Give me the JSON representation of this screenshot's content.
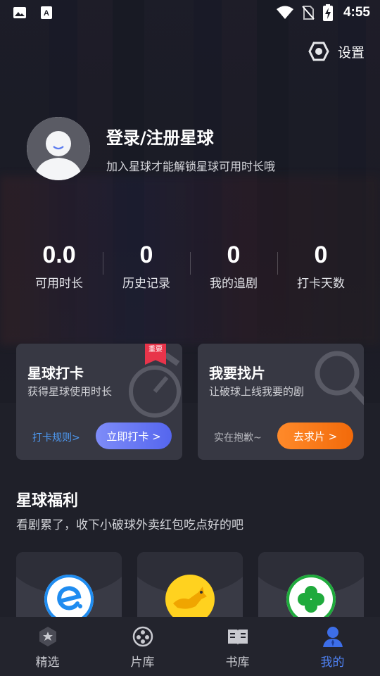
{
  "status_bar": {
    "time": "4:55",
    "icons": [
      "image-icon",
      "text-a-icon",
      "wifi-icon",
      "no-sim-icon",
      "battery-charging-icon"
    ]
  },
  "settings": {
    "label": "设置",
    "icon": "gear-icon"
  },
  "profile": {
    "title": "登录/注册星球",
    "subtitle": "加入星球才能解锁星球可用时长哦"
  },
  "stats": [
    {
      "value": "0.0",
      "label": "可用时长"
    },
    {
      "value": "0",
      "label": "历史记录"
    },
    {
      "value": "0",
      "label": "我的追剧"
    },
    {
      "value": "0",
      "label": "打卡天数"
    }
  ],
  "checkin_card": {
    "title": "星球打卡",
    "subtitle": "获得星球使用时长",
    "badge": "重要",
    "rules_link": "打卡规则>",
    "button": "立即打卡 >"
  },
  "request_card": {
    "title": "我要找片",
    "subtitle": "让破球上线我要的剧",
    "note": "实在抱歉~",
    "button": "去求片 >"
  },
  "welfare": {
    "title": "星球福利",
    "subtitle": "看剧累了，收下小破球外卖红包吃点好的吧",
    "cards": [
      "eleme-logo",
      "meituan-logo",
      "clover-logo"
    ]
  },
  "bottom_nav": [
    {
      "label": "精选",
      "icon": "star-icon",
      "active": false
    },
    {
      "label": "片库",
      "icon": "film-reel-icon",
      "active": false
    },
    {
      "label": "书库",
      "icon": "book-icon",
      "active": false
    },
    {
      "label": "我的",
      "icon": "user-icon",
      "active": true
    }
  ],
  "colors": {
    "background": "#1c1d26",
    "accent_blue": "#4f83f5",
    "button_blue": "#5566ee",
    "button_orange": "#f26a0a",
    "badge_red": "#e8344a"
  }
}
